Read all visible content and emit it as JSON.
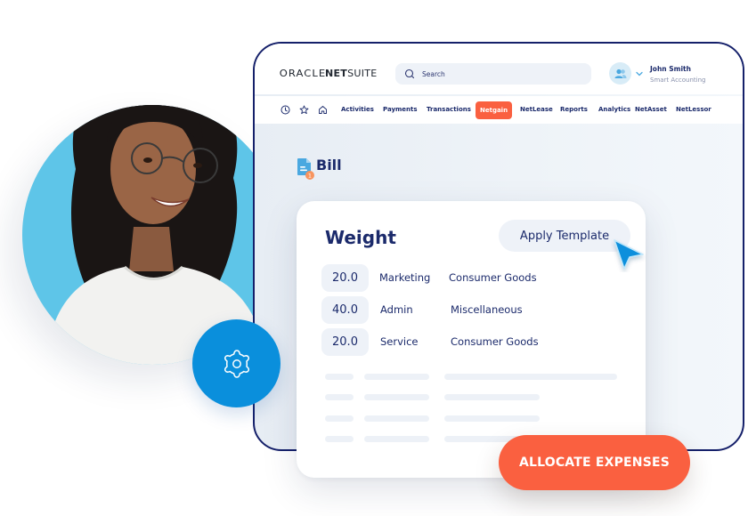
{
  "header": {
    "logo": {
      "oracle": "ORACLE ",
      "net": "NET",
      "suite": "SUITE"
    },
    "search": {
      "placeholder": "Search"
    },
    "user": {
      "name": "John Smith",
      "role": "Smart Accounting"
    }
  },
  "nav": {
    "icons": [
      "clock-icon",
      "star-icon",
      "home-icon"
    ],
    "items": [
      {
        "label": "Activities",
        "active": false
      },
      {
        "label": "Payments",
        "active": false
      },
      {
        "label": "Transactions",
        "active": false
      },
      {
        "label": "Netgain",
        "active": true
      },
      {
        "label": "NetLease",
        "active": false
      },
      {
        "label": "Reports",
        "active": false
      },
      {
        "label": "Analytics",
        "active": false
      },
      {
        "label": "NetAsset",
        "active": false
      },
      {
        "label": "NetLessor",
        "active": false
      }
    ]
  },
  "page": {
    "title": "Bill",
    "badge_count": "1"
  },
  "card": {
    "title": "Weight",
    "apply_button": "Apply Template",
    "rows": [
      {
        "weight": "20.0",
        "department": "Marketing",
        "category": "Consumer Goods"
      },
      {
        "weight": "40.0",
        "department": "Admin",
        "category": "Miscellaneous"
      },
      {
        "weight": "20.0",
        "department": "Service",
        "category": "Consumer Goods"
      }
    ]
  },
  "actions": {
    "allocate": "ALLOCATE EXPENSES"
  },
  "colors": {
    "accent_orange": "#fa6040",
    "navy": "#1b2a6b",
    "blue": "#0a8fdc",
    "sky": "#5ec5e8"
  }
}
